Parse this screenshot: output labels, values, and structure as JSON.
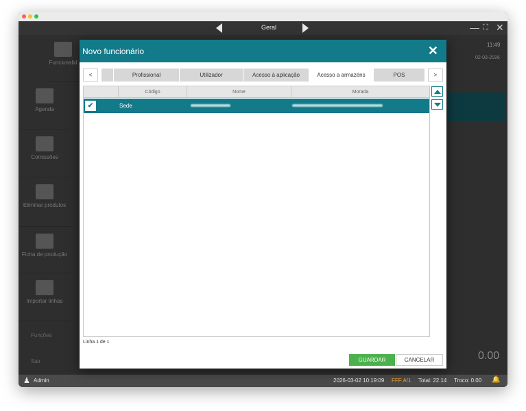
{
  "window": {
    "title": "Geral",
    "controls": {
      "minimize": "—",
      "fullscreen": "⛶",
      "close": "✕"
    },
    "traffic_colors": [
      "#fe5f57",
      "#febc2e",
      "#28c840"
    ]
  },
  "background": {
    "sidebar": [
      {
        "label": "Funcionalid",
        "icon": "gears-icon"
      },
      {
        "label": "Agenda",
        "icon": "calendar-icon"
      },
      {
        "label": "Comissões",
        "icon": "gears-icon"
      },
      {
        "label": "Eliminar produtos",
        "icon": "delete-chart-icon"
      },
      {
        "label": "Ficha de produção",
        "icon": "transfer-icon"
      },
      {
        "label": "Importar linhas",
        "icon": "import-icon"
      }
    ],
    "sidebar_footer": [
      "Funções",
      "Sair"
    ],
    "time": "11:49",
    "date": "02-03-2026",
    "total_display": "0.00"
  },
  "modal": {
    "title": "Novo funcionário",
    "close_icon": "close-icon",
    "tabs": [
      {
        "label": ""
      },
      {
        "label": "Profissional"
      },
      {
        "label": "Utilizador"
      },
      {
        "label": "Acesso à aplicação"
      },
      {
        "label": "Acesso a armazéns"
      },
      {
        "label": "POS"
      }
    ],
    "active_tab": "Acesso a armazéns",
    "nav_prev": "<",
    "nav_next": ">",
    "grid": {
      "columns": [
        "Código",
        "Nome",
        "Morada"
      ],
      "rows": [
        {
          "checked": true,
          "check_mark": "✔",
          "code": "Sede",
          "name": "",
          "address": ""
        }
      ]
    },
    "line_count": "Linha 1 de 1",
    "save_label": "GUARDAR",
    "cancel_label": "CANCELAR"
  },
  "statusbar": {
    "user": "Admin",
    "datetime": "2026-03-02 10:19:09",
    "document": "FFF A/1",
    "total": "Total:  22.14",
    "change": "Troco:  0.00"
  },
  "colors": {
    "accent": "#137a8a",
    "save_button": "#4cb04c",
    "document_badge": "#f0a030"
  }
}
